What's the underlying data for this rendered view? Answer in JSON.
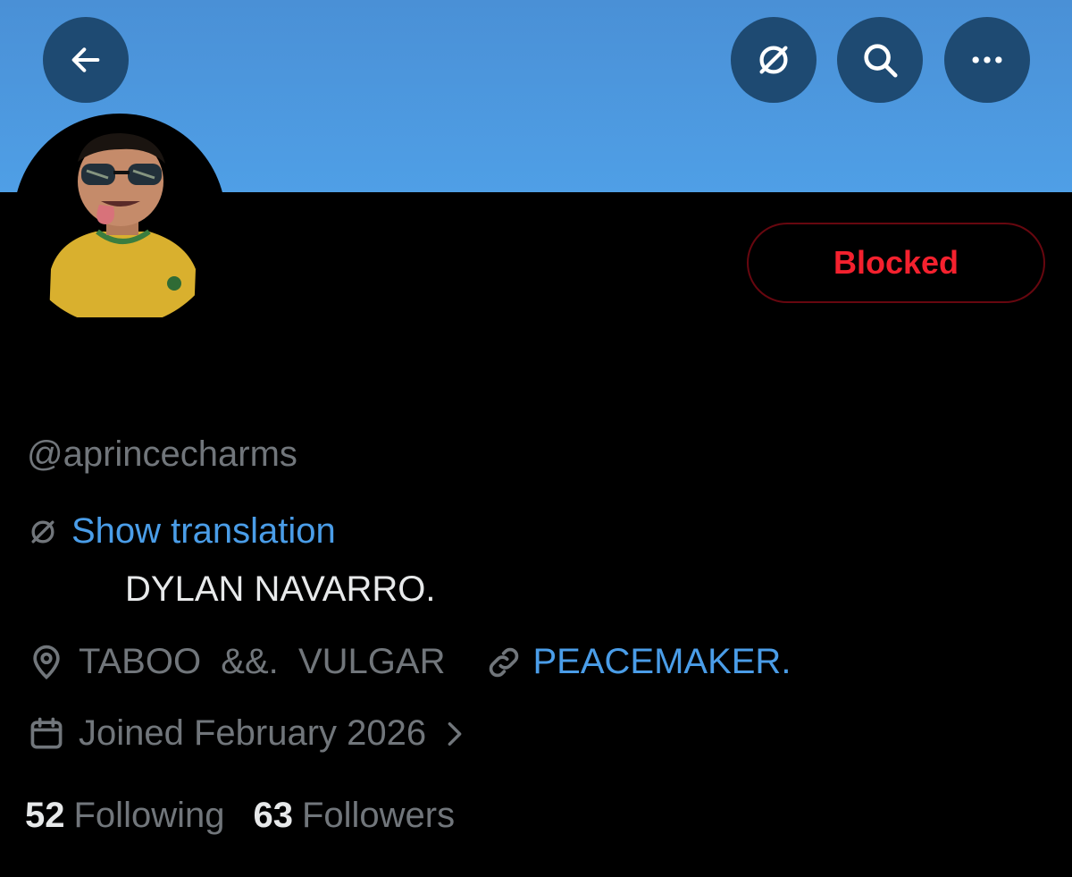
{
  "header": {
    "back_icon": "arrow-left-icon",
    "translate_icon": "translate-icon",
    "search_icon": "search-icon",
    "more_icon": "more-horizontal-icon",
    "banner_color": "#4f9fe6"
  },
  "profile": {
    "block_button_label": "Blocked",
    "handle": "@aprincecharms",
    "show_translation": "Show translation",
    "bio": "DYLAN NAVARRO.",
    "location": "TABOO  &&.  VULGAR",
    "website": "PEACEMAKER.",
    "joined": "Joined February 2026",
    "following_count": "52",
    "following_label": "Following",
    "followers_count": "63",
    "followers_label": "Followers"
  },
  "colors": {
    "accent": "#4a9de8",
    "blocked": "#f4212e",
    "muted": "#71767b"
  }
}
